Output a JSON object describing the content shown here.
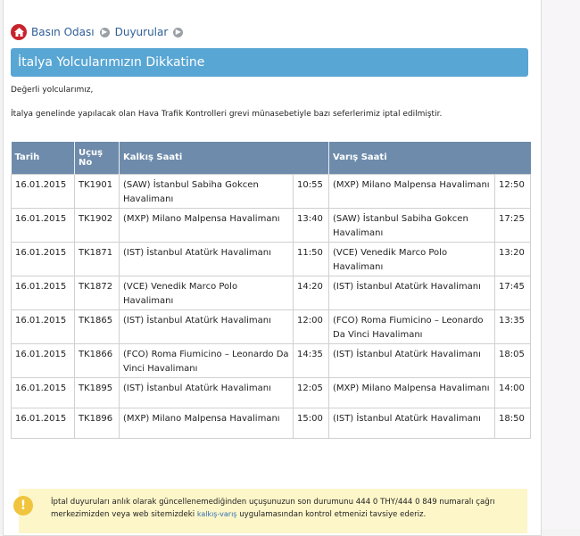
{
  "breadcrumb": {
    "home": "Basın Odası",
    "section": "Duyurular"
  },
  "title": "İtalya Yolcularımızın Dikkatine",
  "intro": {
    "greeting": "Değerli yolcularımız,",
    "message": "İtalya genelinde yapılacak olan Hava Trafik Kontrolleri grevi münasebetiyle bazı seferlerimiz iptal edilmiştir."
  },
  "table": {
    "headers": {
      "date": "Tarih",
      "flight": "Uçuş No",
      "departure": "Kalkış Saati",
      "arrival": "Varış Saati"
    },
    "rows": [
      {
        "date": "16.01.2015",
        "flight": "TK1901",
        "from": "(SAW) İstanbul Sabiha Gokcen Havalimanı",
        "dep": "10:55",
        "to": "(MXP) Milano Malpensa Havalimanı",
        "arr": "12:50"
      },
      {
        "date": "16.01.2015",
        "flight": "TK1902",
        "from": "(MXP) Milano Malpensa Havalimanı",
        "dep": "13:40",
        "to": "(SAW) İstanbul Sabiha Gokcen Havalimanı",
        "arr": "17:25"
      },
      {
        "date": "16.01.2015",
        "flight": "TK1871",
        "from": "(IST) İstanbul Atatürk Havalimanı",
        "dep": "11:50",
        "to": "(VCE) Venedik Marco Polo Havalimanı",
        "arr": "13:20"
      },
      {
        "date": "16.01.2015",
        "flight": "TK1872",
        "from": "(VCE) Venedik Marco Polo Havalimanı",
        "dep": "14:20",
        "to": "(IST) İstanbul Atatürk Havalimanı",
        "arr": "17:45"
      },
      {
        "date": "16.01.2015",
        "flight": "TK1865",
        "from": "(IST) İstanbul Atatürk Havalimanı",
        "dep": "12:00",
        "to": "(FCO) Roma Fiumicino – Leonardo Da Vinci Havalimanı",
        "arr": "13:35"
      },
      {
        "date": "16.01.2015",
        "flight": "TK1866",
        "from": "(FCO) Roma Fiumicino – Leonardo Da Vinci Havalimanı",
        "dep": "14:35",
        "to": "(IST) İstanbul Atatürk Havalimanı",
        "arr": "18:05"
      },
      {
        "date": "16.01.2015",
        "flight": "TK1895",
        "from": "(IST) İstanbul Atatürk Havalimanı",
        "dep": "12:05",
        "to": "(MXP) Milano Malpensa Havalimanı",
        "arr": "14:00"
      },
      {
        "date": "16.01.2015",
        "flight": "TK1896",
        "from": "(MXP) Milano Malpensa Havalimanı",
        "dep": "15:00",
        "to": "(IST) İstanbul Atatürk Havalimanı",
        "arr": "18:50"
      }
    ]
  },
  "notice": {
    "text_before": "İptal duyuruları anlık olarak güncellenemediğinden uçuşunuzun son durumunu 444 0 THY/444 0 849 numaralı çağrı merkezimizden veya web sitemizdeki ",
    "link": "kalkış-varış",
    "text_after": " uygulamasından kontrol etmenizi tavsiye ederiz.",
    "icon_symbol": "!"
  },
  "icons": {
    "home": "home-icon",
    "chevron": "chevron-right-icon",
    "warning": "warning-icon"
  },
  "colors": {
    "title_bar": "#58a6d4",
    "table_header": "#6e8bab",
    "home_icon": "#c8232c",
    "notice_bg": "#fdf6c9",
    "warning_icon": "#f0c43c",
    "link": "#2f5f96"
  }
}
